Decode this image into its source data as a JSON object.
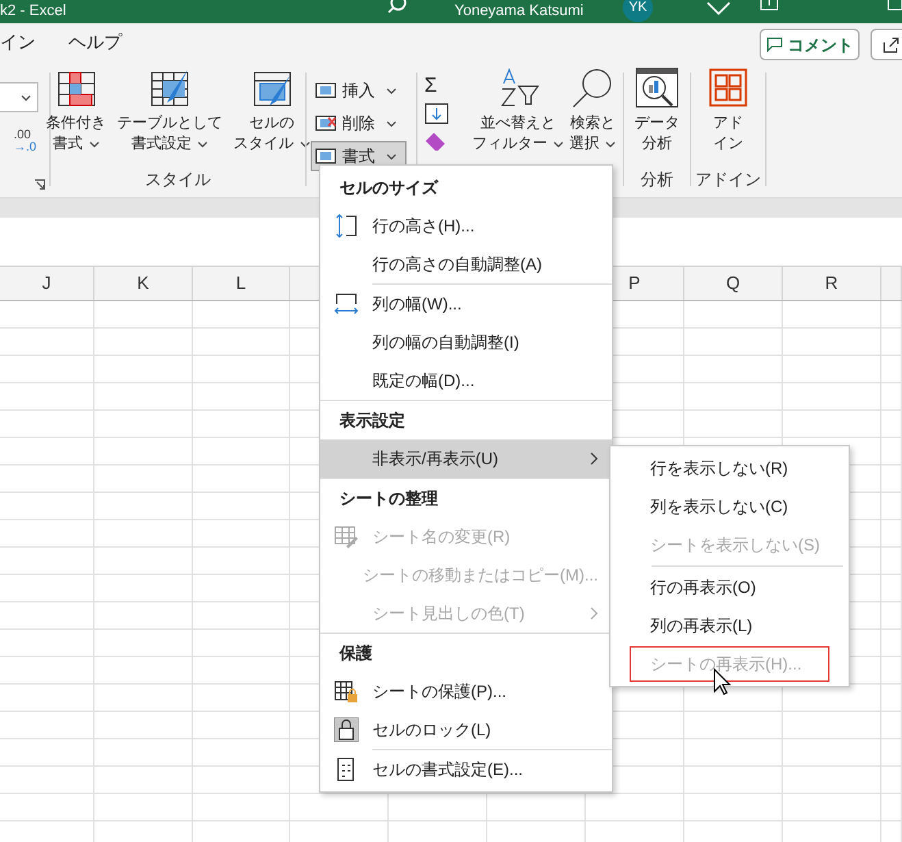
{
  "title_bar": {
    "title": "k2 - Excel",
    "user": "Yoneyama Katsumi",
    "avatar": "YK"
  },
  "ribbon_tabs": [
    {
      "label": "イン",
      "selected": false
    },
    {
      "label": "ヘルプ",
      "selected": false
    }
  ],
  "comment_button": "コメント",
  "ribbon": {
    "number_format_icon": [
      ".00",
      "→.0"
    ],
    "autosum_symbol": "Σ",
    "style_group": {
      "label": "スタイル",
      "buttons": [
        {
          "lines": [
            "条件付き",
            "書式"
          ]
        },
        {
          "lines": [
            "テーブルとして",
            "書式設定"
          ]
        },
        {
          "lines": [
            "セルの",
            "スタイル"
          ]
        }
      ]
    },
    "cells_group": {
      "buttons": [
        {
          "label": "挿入",
          "selected": false
        },
        {
          "label": "削除",
          "selected": false
        },
        {
          "label": "書式",
          "selected": true
        }
      ]
    },
    "edit_group": {
      "buttons": [
        {
          "lines": [
            "並べ替えと",
            "フィルター"
          ]
        },
        {
          "lines": [
            "検索と",
            "選択"
          ]
        }
      ]
    },
    "analysis_group": {
      "label": "分析",
      "button": [
        "データ",
        "分析"
      ]
    },
    "addin_group": {
      "label": "アドイン",
      "button": [
        "アド",
        "イン"
      ]
    }
  },
  "column_headers_left": [
    "J",
    "K",
    "L"
  ],
  "column_headers_right": [
    "P",
    "Q",
    "R"
  ],
  "format_menu": {
    "sections": [
      {
        "title": "セルのサイズ",
        "items": [
          {
            "label": "行の高さ(H)...",
            "disabled": false,
            "selected": false,
            "submenu": false,
            "separator_before": false
          },
          {
            "label": "行の高さの自動調整(A)",
            "disabled": false,
            "selected": false,
            "submenu": false,
            "separator_before": false
          },
          {
            "label": "列の幅(W)...",
            "disabled": false,
            "selected": false,
            "submenu": false,
            "separator_before": true
          },
          {
            "label": "列の幅の自動調整(I)",
            "disabled": false,
            "selected": false,
            "submenu": false,
            "separator_before": false
          },
          {
            "label": "既定の幅(D)...",
            "disabled": false,
            "selected": false,
            "submenu": false,
            "separator_before": false
          }
        ]
      },
      {
        "title": "表示設定",
        "items": [
          {
            "label": "非表示/再表示(U)",
            "disabled": false,
            "selected": true,
            "submenu": true,
            "separator_before": false
          }
        ]
      },
      {
        "title": "シートの整理",
        "items": [
          {
            "label": "シート名の変更(R)",
            "disabled": true,
            "selected": false,
            "submenu": false,
            "separator_before": false
          },
          {
            "label": "シートの移動またはコピー(M)...",
            "disabled": true,
            "selected": false,
            "submenu": false,
            "separator_before": false
          },
          {
            "label": "シート見出しの色(T)",
            "disabled": true,
            "selected": false,
            "submenu": true,
            "separator_before": false
          }
        ]
      },
      {
        "title": "保護",
        "items": [
          {
            "label": "シートの保護(P)...",
            "disabled": false,
            "selected": false,
            "submenu": false,
            "separator_before": false
          },
          {
            "label": "セルのロック(L)",
            "disabled": false,
            "selected": false,
            "submenu": false,
            "separator_before": false
          },
          {
            "label": "セルの書式設定(E)...",
            "disabled": false,
            "selected": false,
            "submenu": false,
            "separator_before": true
          }
        ]
      }
    ]
  },
  "hide_submenu": {
    "items": [
      {
        "label": "行を表示しない(R)",
        "disabled": false,
        "highlighted": false,
        "separator_before": false
      },
      {
        "label": "列を表示しない(C)",
        "disabled": false,
        "highlighted": false,
        "separator_before": false
      },
      {
        "label": "シートを表示しない(S)",
        "disabled": true,
        "highlighted": false,
        "separator_before": false
      },
      {
        "label": "行の再表示(O)",
        "disabled": false,
        "highlighted": false,
        "separator_before": true
      },
      {
        "label": "列の再表示(L)",
        "disabled": false,
        "highlighted": false,
        "separator_before": false
      },
      {
        "label": "シートの再表示(H)...",
        "disabled": true,
        "highlighted": true,
        "separator_before": false
      }
    ]
  }
}
